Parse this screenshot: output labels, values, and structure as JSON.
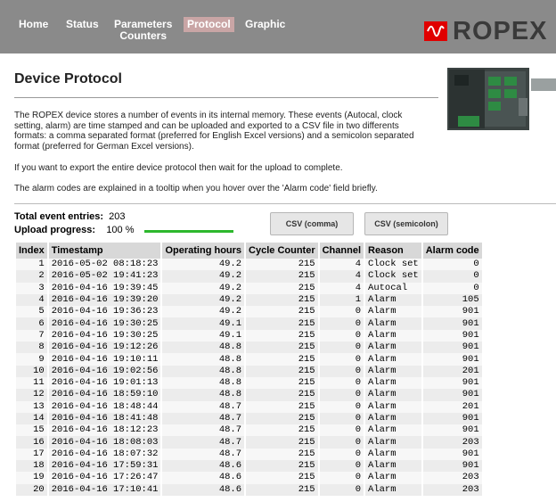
{
  "nav": {
    "items": [
      {
        "label": "Home"
      },
      {
        "label": "Status"
      },
      {
        "label": "Parameters\nCounters"
      },
      {
        "label": "Protocol"
      },
      {
        "label": "Graphic"
      }
    ],
    "active": "Protocol",
    "logo_text": "ROPEX"
  },
  "colors": {
    "header_bg": "#8a8a8a",
    "active_tab": "#c9a5a5",
    "logo_red": "#e00000",
    "progress": "#2db82d"
  },
  "page": {
    "title": "Device Protocol",
    "paragraph1": "The ROPEX device stores a number of events in its internal memory. These events (Autocal, clock setting, alarm) are time stamped and can be uploaded and exported to a CSV file in two differents formats: a comma separated format (preferred for English Excel versions) and a semicolon separated format (preferred for German Excel versions).",
    "paragraph2": "If you want to export the entire device protocol then wait for the upload to complete.",
    "paragraph3": "The alarm codes are explained in a tooltip when you hover over the 'Alarm code' field briefly."
  },
  "stats": {
    "total_label": "Total event entries:",
    "total_value": "203",
    "upload_label": "Upload progress:",
    "upload_value": "100 %",
    "upload_fraction": 1.0
  },
  "buttons": {
    "csv_comma": "CSV (comma)",
    "csv_semicolon": "CSV (semicolon)"
  },
  "table": {
    "headers": [
      "Index",
      "Timestamp",
      "Operating hours",
      "Cycle Counter",
      "Channel",
      "Reason",
      "Alarm code"
    ],
    "rows": [
      [
        "1",
        "2016-05-02 08:18:23",
        "49.2",
        "215",
        "4",
        "Clock set",
        "0"
      ],
      [
        "2",
        "2016-05-02 19:41:23",
        "49.2",
        "215",
        "4",
        "Clock set",
        "0"
      ],
      [
        "3",
        "2016-04-16 19:39:45",
        "49.2",
        "215",
        "4",
        "Autocal",
        "0"
      ],
      [
        "4",
        "2016-04-16 19:39:20",
        "49.2",
        "215",
        "1",
        "Alarm",
        "105"
      ],
      [
        "5",
        "2016-04-16 19:36:23",
        "49.2",
        "215",
        "0",
        "Alarm",
        "901"
      ],
      [
        "6",
        "2016-04-16 19:30:25",
        "49.1",
        "215",
        "0",
        "Alarm",
        "901"
      ],
      [
        "7",
        "2016-04-16 19:30:25",
        "49.1",
        "215",
        "0",
        "Alarm",
        "901"
      ],
      [
        "8",
        "2016-04-16 19:12:26",
        "48.8",
        "215",
        "0",
        "Alarm",
        "901"
      ],
      [
        "9",
        "2016-04-16 19:10:11",
        "48.8",
        "215",
        "0",
        "Alarm",
        "901"
      ],
      [
        "10",
        "2016-04-16 19:02:56",
        "48.8",
        "215",
        "0",
        "Alarm",
        "201"
      ],
      [
        "11",
        "2016-04-16 19:01:13",
        "48.8",
        "215",
        "0",
        "Alarm",
        "901"
      ],
      [
        "12",
        "2016-04-16 18:59:10",
        "48.8",
        "215",
        "0",
        "Alarm",
        "901"
      ],
      [
        "13",
        "2016-04-16 18:48:44",
        "48.7",
        "215",
        "0",
        "Alarm",
        "201"
      ],
      [
        "14",
        "2016-04-16 18:41:48",
        "48.7",
        "215",
        "0",
        "Alarm",
        "901"
      ],
      [
        "15",
        "2016-04-16 18:12:23",
        "48.7",
        "215",
        "0",
        "Alarm",
        "901"
      ],
      [
        "16",
        "2016-04-16 18:08:03",
        "48.7",
        "215",
        "0",
        "Alarm",
        "203"
      ],
      [
        "17",
        "2016-04-16 18:07:32",
        "48.7",
        "215",
        "0",
        "Alarm",
        "901"
      ],
      [
        "18",
        "2016-04-16 17:59:31",
        "48.6",
        "215",
        "0",
        "Alarm",
        "901"
      ],
      [
        "19",
        "2016-04-16 17:26:47",
        "48.6",
        "215",
        "0",
        "Alarm",
        "203"
      ],
      [
        "20",
        "2016-04-16 17:10:41",
        "48.6",
        "215",
        "0",
        "Alarm",
        "203"
      ]
    ]
  }
}
